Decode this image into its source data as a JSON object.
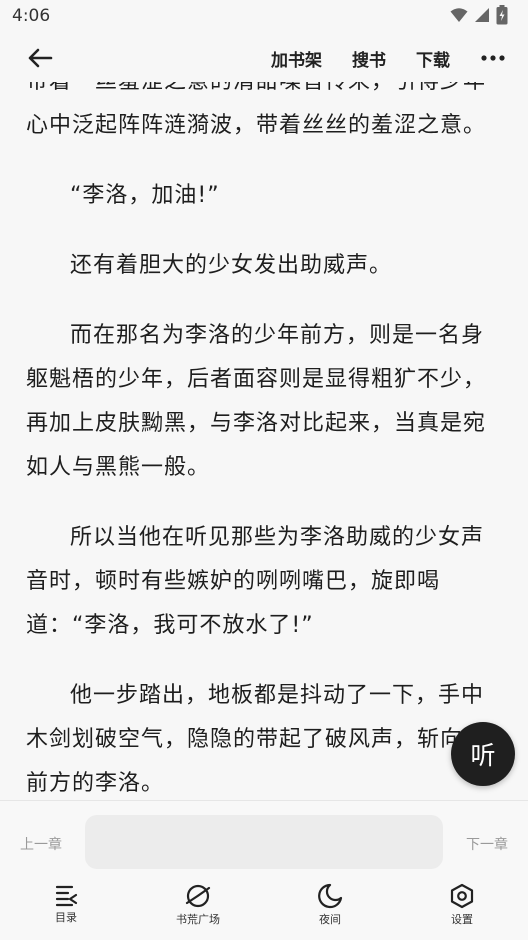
{
  "status_bar": {
    "time": "4:06"
  },
  "topbar": {
    "actions": [
      "加书架",
      "搜书",
      "下载"
    ]
  },
  "content": {
    "paragraphs": [
      {
        "text": "带着一丝羞涩之意的清甜嗓音传来，引得少年心中泛起阵阵涟漪波，带着丝丝的羞涩之意。",
        "indent": false
      },
      {
        "text": "“李洛，加油!”",
        "indent": true
      },
      {
        "text": "还有着胆大的少女发出助威声。",
        "indent": true
      },
      {
        "text": "而在那名为李洛的少年前方，则是一名身躯魁梧的少年，后者面容则是显得粗犷不少，再加上皮肤黝黑，与李洛对比起来，当真是宛如人与黑熊一般。",
        "indent": true
      },
      {
        "text": "所以当他在听见那些为李洛助威的少女声音时，顿时有些嫉妒的咧咧嘴巴，旋即喝道：“李洛，我可不放水了!”",
        "indent": true
      },
      {
        "text": "他一步踏出，地板都是抖动了一下，手中木剑划破空气，隐隐的带起了破风声，斩向了前方的李洛。",
        "indent": true
      }
    ]
  },
  "listen_button": {
    "label": "听"
  },
  "chapter_nav": {
    "prev": "上一章",
    "next": "下一章"
  },
  "bottom_nav": {
    "items": [
      {
        "label": "目录",
        "icon": "catalog-icon"
      },
      {
        "label": "书荒广场",
        "icon": "planet-icon"
      },
      {
        "label": "夜间",
        "icon": "moon-icon"
      },
      {
        "label": "设置",
        "icon": "settings-icon"
      }
    ]
  }
}
